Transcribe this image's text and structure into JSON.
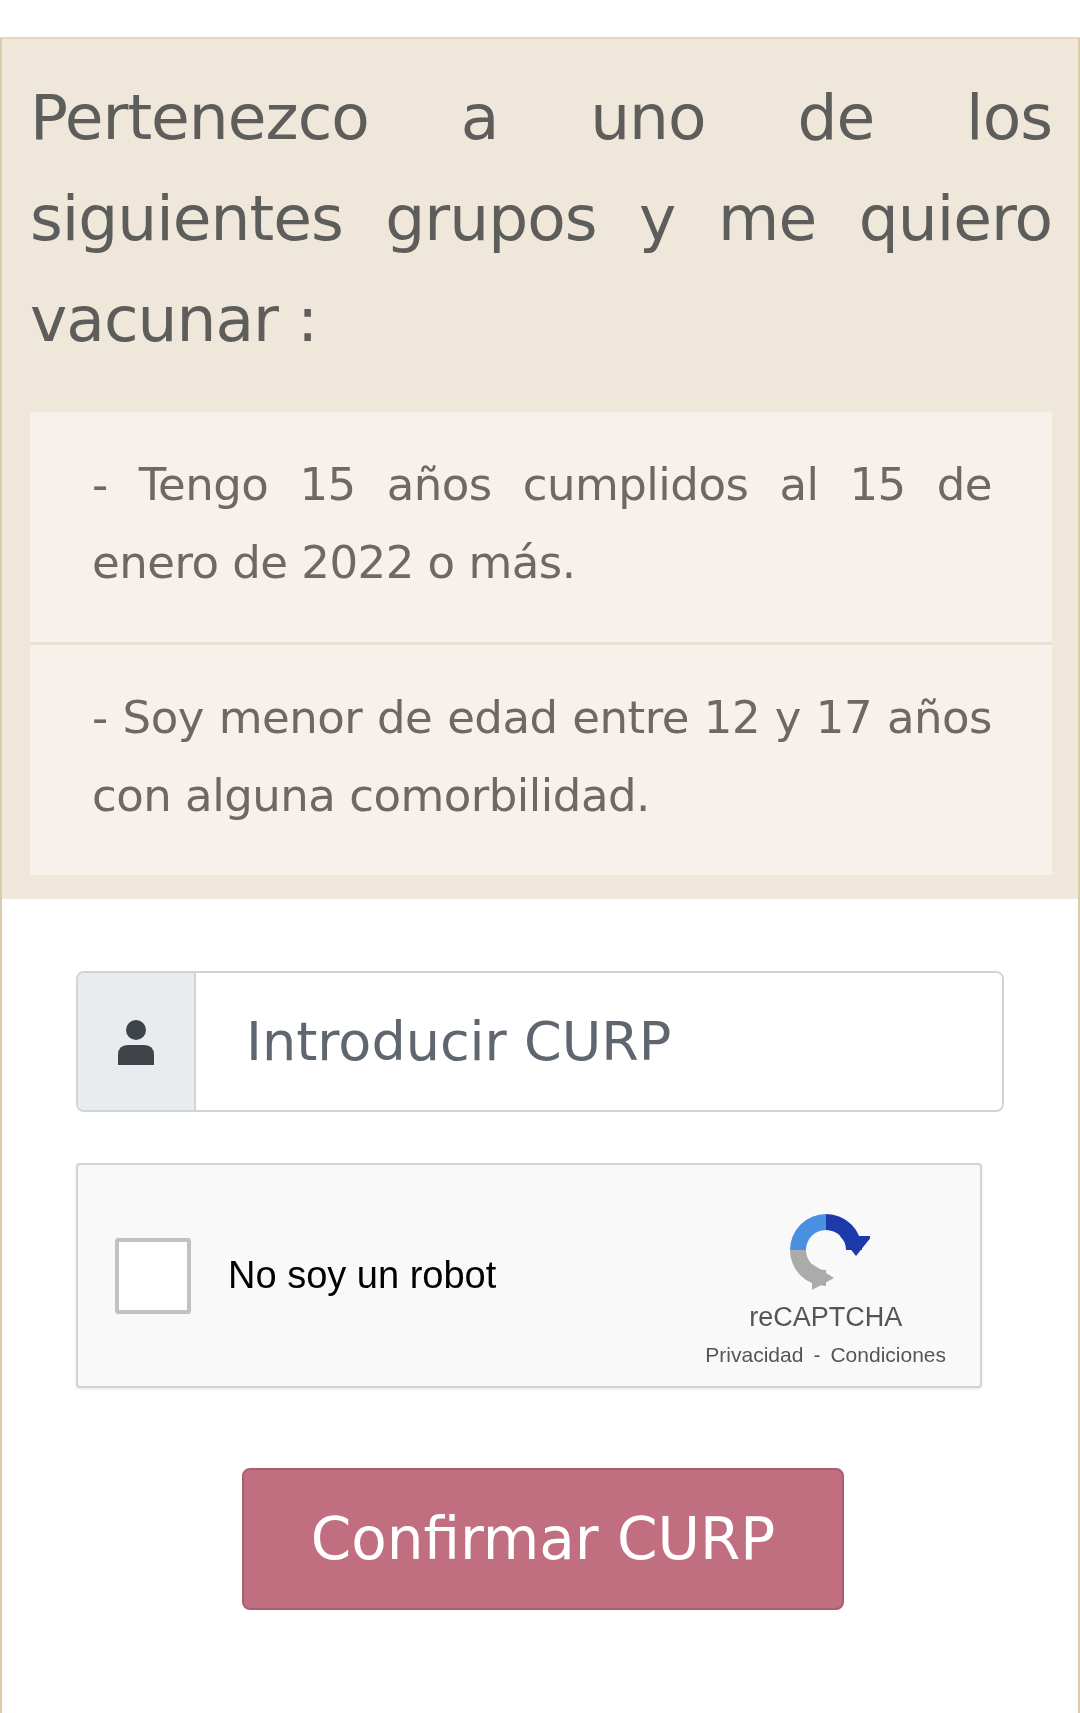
{
  "heading": "Pertenezco a uno de los siguientes grupos y me quiero vacunar :",
  "groups": [
    "- Tengo 15 años cumplidos al 15 de enero de 2022 o más.",
    "- Soy menor de edad entre 12 y 17 años con alguna comorbilidad."
  ],
  "curp_field": {
    "placeholder": "Introducir CURP"
  },
  "captcha": {
    "label": "No soy un robot",
    "checked": false,
    "brand": "reCAPTCHA",
    "privacy": "Privacidad",
    "separator": "-",
    "terms": "Condiciones"
  },
  "button": "Confirmar CURP"
}
